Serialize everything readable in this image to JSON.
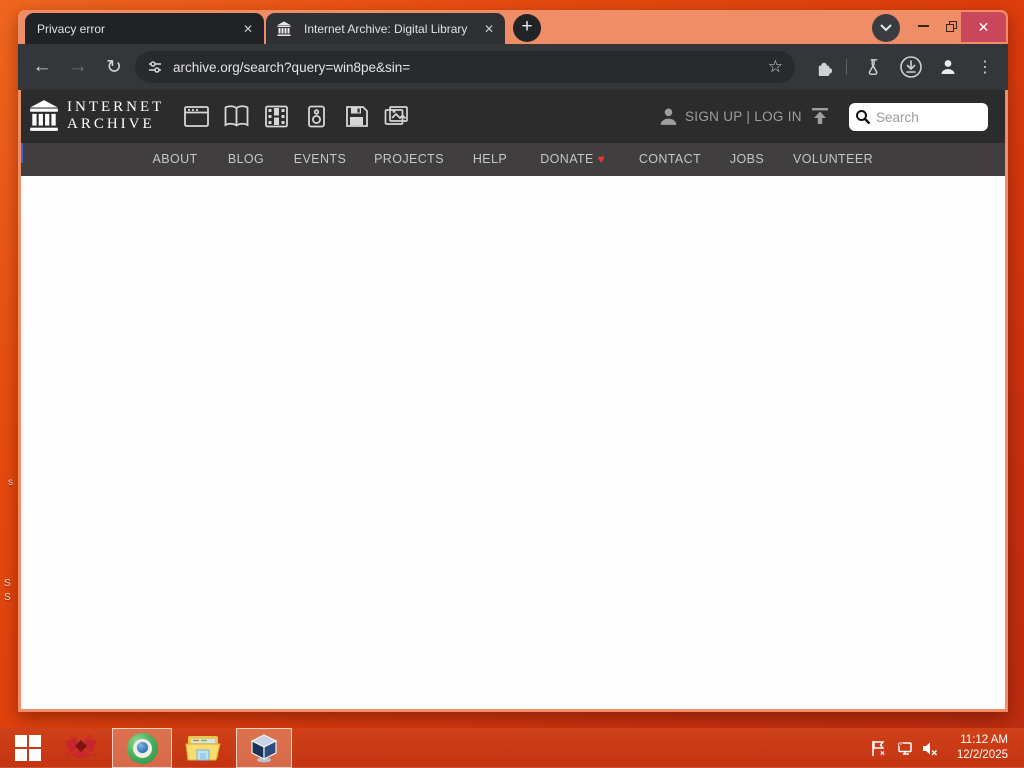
{
  "browser": {
    "tabs": [
      {
        "title": "Privacy error"
      },
      {
        "title": "Internet Archive: Digital Library"
      }
    ],
    "url": "archive.org/search?query=win8pe&sin="
  },
  "ia": {
    "wordmark": [
      "INTERNET",
      "ARCHIVE"
    ],
    "account_text": "SIGN UP | LOG IN",
    "search_placeholder": "Search",
    "nav": [
      "ABOUT",
      "BLOG",
      "EVENTS",
      "PROJECTS",
      "HELP",
      "DONATE",
      "CONTACT",
      "JOBS",
      "VOLUNTEER"
    ],
    "donate_heart": "♥"
  },
  "taskbar": {
    "clock": {
      "time": "11:12 AM",
      "date": "12/2/2025"
    }
  },
  "desktop": {
    "icon_label_fragments": [
      "s",
      "S",
      "S"
    ]
  },
  "glyphs": {
    "back": "←",
    "forward": "→",
    "reload": "↻",
    "star": "☆",
    "menu": "⋮",
    "plus": "+",
    "close": "✕",
    "tab_close": "✕"
  },
  "colors": {
    "desktop_top": "#f0671f",
    "desktop_bottom": "#bd2c10",
    "titlebar": "#ee8d66",
    "close_button": "#c9485b",
    "toolbar": "#35363a",
    "tab_inactive": "#212226",
    "tab_active": "#2f3034",
    "omnibox": "#282a2e",
    "ia_header": "#2c2c2c",
    "ia_navbar": "#403e3e",
    "donate_heart": "#e53935",
    "taskbar": "#c93a15",
    "search_box": "#ffffff"
  }
}
